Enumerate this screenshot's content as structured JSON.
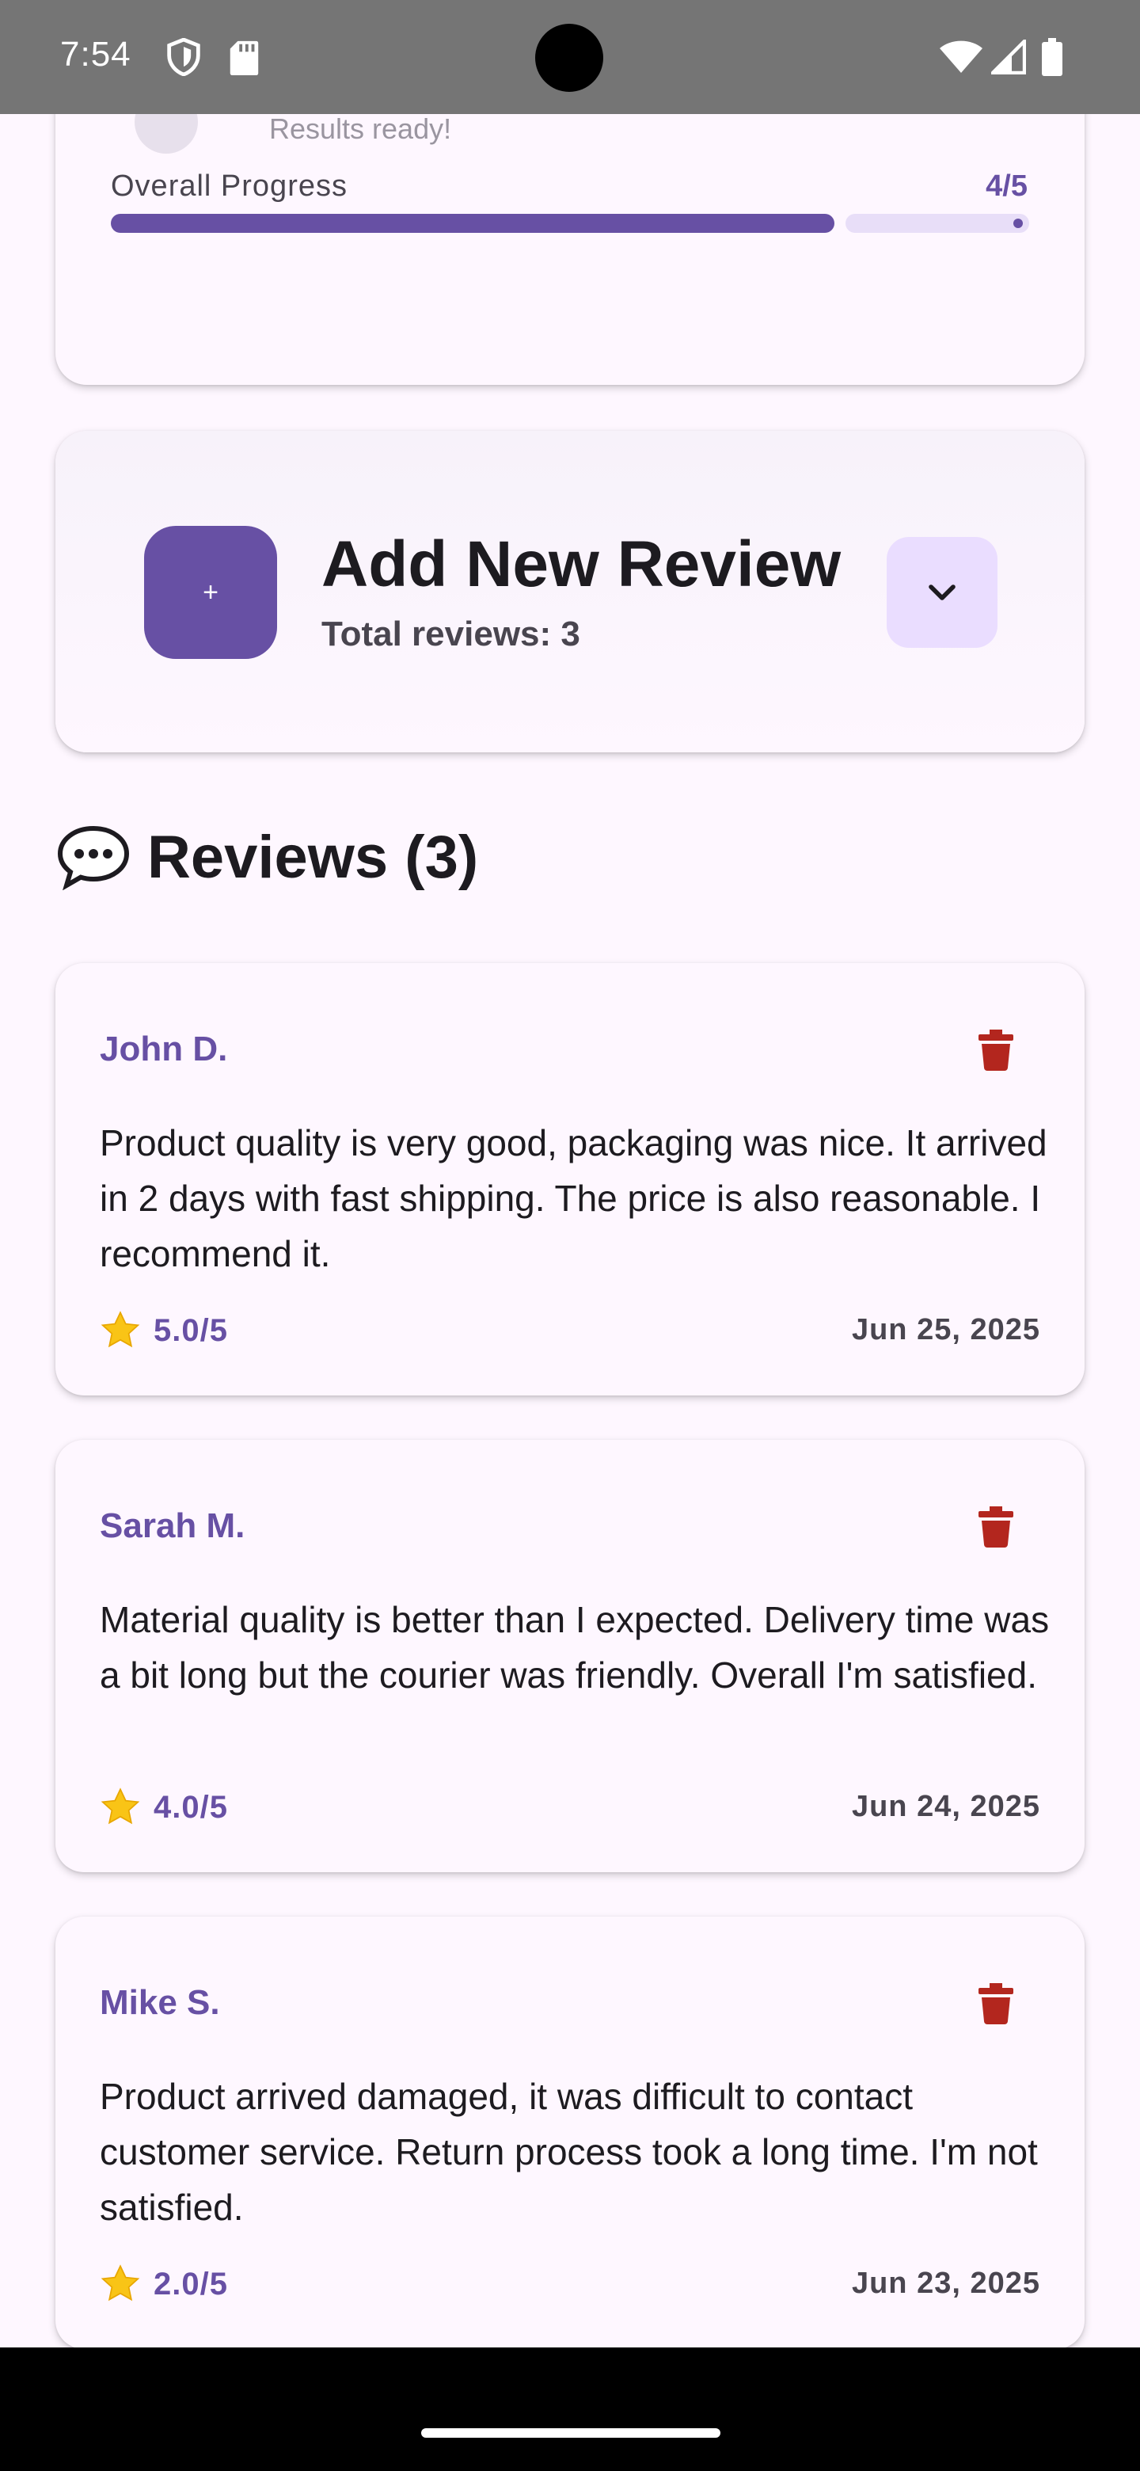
{
  "status_bar": {
    "time": "7:54",
    "icons": [
      "shield-icon",
      "sd-card-icon",
      "wifi-icon",
      "signal-icon",
      "battery-icon"
    ]
  },
  "progress_card": {
    "peek_text": "Results ready!",
    "label": "Overall Progress",
    "value": "4/5",
    "progress_fraction": 0.8
  },
  "add_review": {
    "button_label": "+",
    "title": "Add New Review",
    "subtitle": "Total reviews: 3",
    "toggle_icon": "chevron-down-icon"
  },
  "reviews_section": {
    "icon": "speech-bubble-icon",
    "heading": "Reviews (3)"
  },
  "reviews": [
    {
      "author": "John D.",
      "text": "Product quality is very good, packaging was nice. It arrived in 2 days with fast shipping. The price is also reasonable. I recommend it.",
      "rating": "5.0/5",
      "date": "Jun 25, 2025"
    },
    {
      "author": "Sarah M.",
      "text": "Material quality is better than I expected. Delivery time was a bit long but the courier was friendly. Overall I'm satisfied.",
      "rating": "4.0/5",
      "date": "Jun 24, 2025"
    },
    {
      "author": "Mike S.",
      "text": "Product arrived damaged, it was difficult to contact customer service. Return process took a long time. I'm not satisfied.",
      "rating": "2.0/5",
      "date": "Jun 23, 2025"
    }
  ],
  "colors": {
    "primary": "#6750A4",
    "primary_container": "#EADDFF",
    "surface": "#FEF7FF",
    "delete": "#B3261E",
    "star": "#F9C416",
    "status_bar": "#757575"
  }
}
